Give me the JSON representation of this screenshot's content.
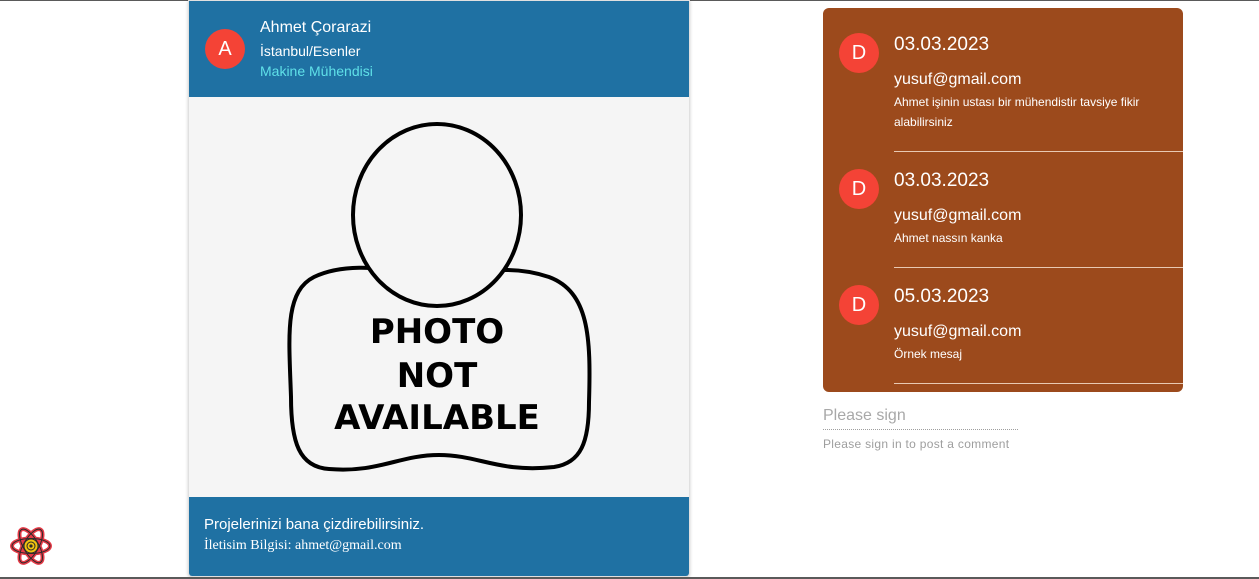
{
  "profile": {
    "avatar_letter": "A",
    "name": "Ahmet Çorarazi",
    "location": "İstanbul/Esenler",
    "job": "Makine Mühendisi",
    "photo_placeholder_lines": [
      "PHOTO",
      "NOT",
      "AVAILABLE"
    ],
    "footer_text": "Projelerinizi bana çizdirebilirsiniz.",
    "contact": "İletisim Bilgisi: ahmet@gmail.com"
  },
  "comments": [
    {
      "avatar_letter": "D",
      "date": "03.03.2023",
      "email": "yusuf@gmail.com",
      "text": "Ahmet işinin ustası bir mühendistir tavsiye fikir alabilirsiniz"
    },
    {
      "avatar_letter": "D",
      "date": "03.03.2023",
      "email": "yusuf@gmail.com",
      "text": "Ahmet nassın kanka"
    },
    {
      "avatar_letter": "D",
      "date": "05.03.2023",
      "email": "yusuf@gmail.com",
      "text": "Örnek mesaj"
    }
  ],
  "comment_form": {
    "placeholder": "Please sign",
    "helper": "Please sign in to post a comment"
  },
  "icons": {
    "devtools": "react-devtools-icon"
  },
  "colors": {
    "card_blue": "#1f71a3",
    "comments_brown": "#9c4a1c",
    "avatar_red": "#f44336",
    "job_cyan": "#5fe0e8"
  }
}
